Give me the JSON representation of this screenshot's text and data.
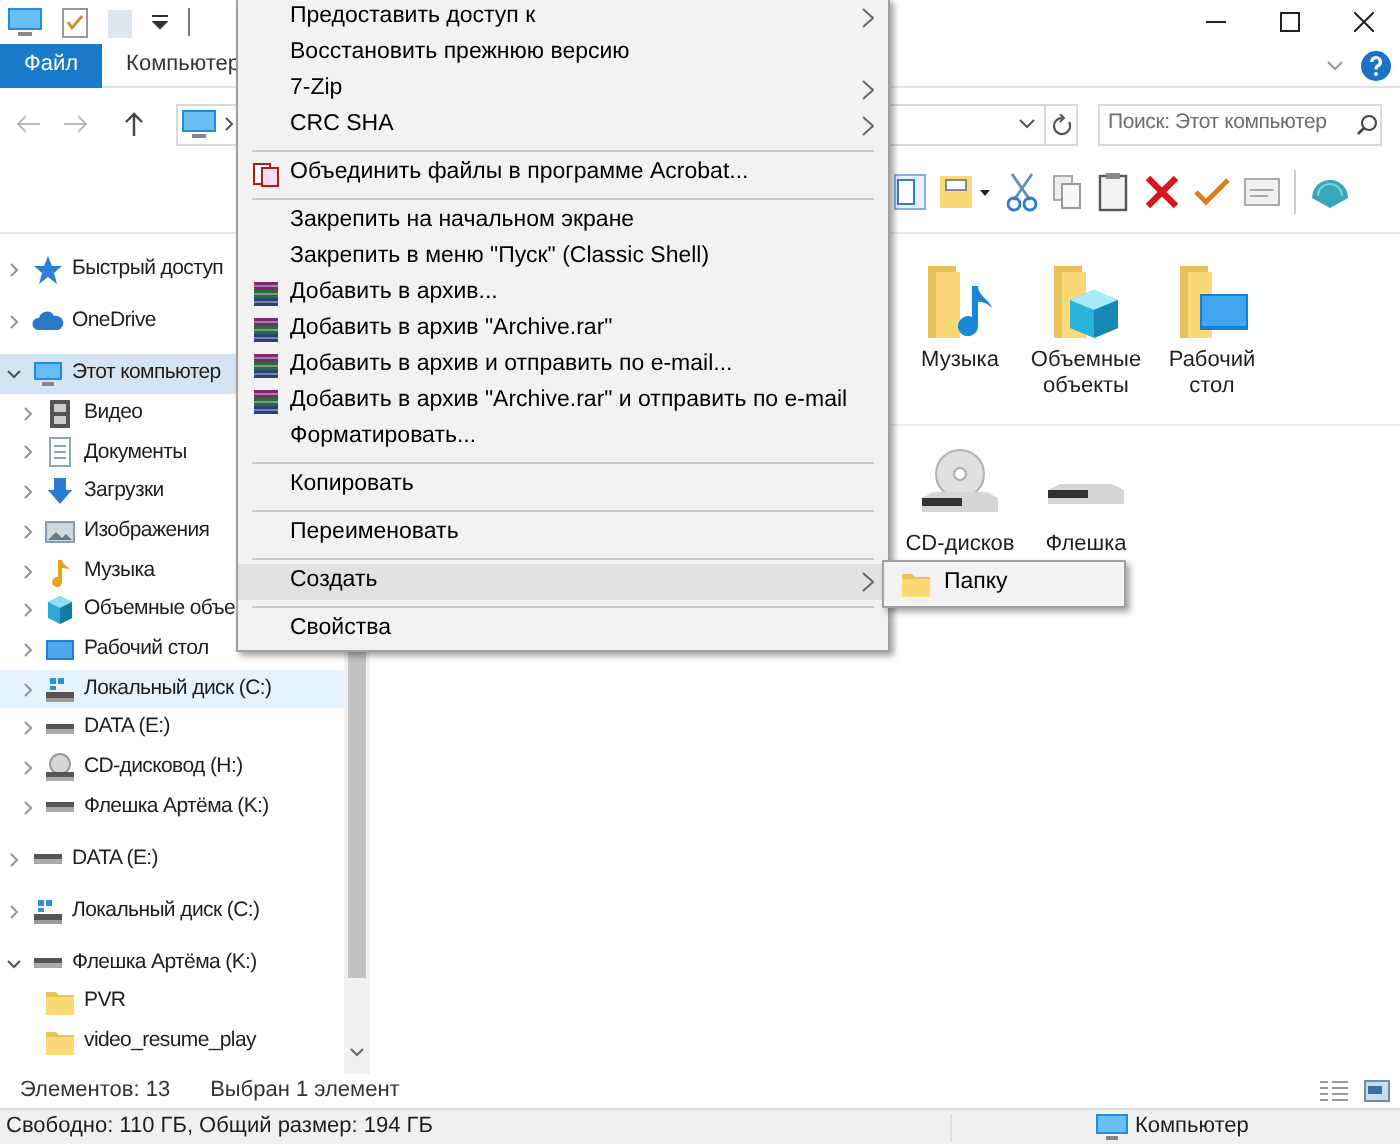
{
  "ribbon_tabs": [
    {
      "label": "Файл",
      "kind": "file"
    },
    {
      "label": "Компьютер",
      "kind": "tab"
    }
  ],
  "search": {
    "placeholder": "Поиск: Этот компьютер"
  },
  "navigation": [
    {
      "label": "Быстрый доступ",
      "kind": "star",
      "expanded": false,
      "selected": false,
      "hovered": false
    },
    {
      "label": "OneDrive",
      "kind": "cloud",
      "expanded": false,
      "selected": false,
      "hovered": false
    },
    {
      "label": "Этот компьютер",
      "kind": "pc",
      "expanded": true,
      "selected": true,
      "hovered": false,
      "children": [
        {
          "label": "Видео",
          "kind": "film",
          "expanded": false,
          "selected": false,
          "hovered": false
        },
        {
          "label": "Документы",
          "kind": "docs",
          "expanded": false,
          "selected": false,
          "hovered": false
        },
        {
          "label": "Загрузки",
          "kind": "download",
          "expanded": false,
          "selected": false,
          "hovered": false
        },
        {
          "label": "Изображения",
          "kind": "images",
          "expanded": false,
          "selected": false,
          "hovered": false
        },
        {
          "label": "Музыка",
          "kind": "music",
          "expanded": false,
          "selected": false,
          "hovered": false
        },
        {
          "label": "Объемные объе",
          "kind": "cube",
          "expanded": false,
          "selected": false,
          "hovered": false
        },
        {
          "label": "Рабочий стол",
          "kind": "desktop",
          "expanded": false,
          "selected": false,
          "hovered": false
        },
        {
          "label": "Локальный диск (C:)",
          "kind": "sysdisk",
          "expanded": false,
          "selected": false,
          "hovered": true
        },
        {
          "label": "DATA (E:)",
          "kind": "drive",
          "expanded": false,
          "selected": false,
          "hovered": false
        },
        {
          "label": "CD-дисковод (H:)",
          "kind": "cd",
          "expanded": false,
          "selected": false,
          "hovered": false
        },
        {
          "label": "Флешка Артёма (K:)",
          "kind": "drive",
          "expanded": false,
          "selected": false,
          "hovered": false
        }
      ]
    },
    {
      "label": "DATA (E:)",
      "kind": "drive",
      "expanded": false,
      "selected": false,
      "hovered": false
    },
    {
      "label": "Локальный диск (C:)",
      "kind": "sysdisk",
      "expanded": false,
      "selected": false,
      "hovered": false
    },
    {
      "label": "Флешка Артёма (K:)",
      "kind": "drive",
      "expanded": true,
      "selected": false,
      "hovered": false,
      "children": [
        {
          "label": "PVR",
          "kind": "folder",
          "selected": false,
          "hovered": false
        },
        {
          "label": "video_resume_play",
          "kind": "folder",
          "selected": false,
          "hovered": false
        }
      ]
    }
  ],
  "content": {
    "groups": [
      {
        "items": [
          {
            "label": "Музыка",
            "kind": "music"
          },
          {
            "label": "Объемные объекты",
            "kind": "cube"
          },
          {
            "label": "Рабочий стол",
            "kind": "desktop"
          }
        ]
      },
      {
        "items": [
          {
            "label": "CD-дисков",
            "kind": "cd"
          },
          {
            "label": "Флешка",
            "kind": "drive"
          }
        ]
      }
    ]
  },
  "status": {
    "item_count": "Элементов: 13",
    "selection": "Выбран 1 элемент"
  },
  "details_bar": {
    "free_space": "Свободно: 110 ГБ, Общий размер: 194 ГБ",
    "location": "Компьютер"
  },
  "context_menu": {
    "items": [
      {
        "kind": "item",
        "label": "Предоставить доступ к",
        "submenu": true,
        "selected": false
      },
      {
        "kind": "item",
        "label": "Восстановить прежнюю версию",
        "submenu": false,
        "selected": false
      },
      {
        "kind": "item",
        "label": "7-Zip",
        "submenu": true,
        "selected": false
      },
      {
        "kind": "item",
        "label": "CRC SHA",
        "submenu": true,
        "selected": false
      },
      {
        "kind": "separator"
      },
      {
        "kind": "acrobat",
        "label": "Объединить файлы в программе Acrobat...",
        "submenu": false,
        "selected": false
      },
      {
        "kind": "separator"
      },
      {
        "kind": "item",
        "label": "Закрепить на начальном экране",
        "submenu": false,
        "selected": false
      },
      {
        "kind": "item",
        "label": "Закрепить в меню \"Пуск\" (Classic Shell)",
        "submenu": false,
        "selected": false
      },
      {
        "kind": "archive",
        "label": "Добавить в архив...",
        "submenu": false,
        "selected": false
      },
      {
        "kind": "archive",
        "label": "Добавить в архив \"Archive.rar\"",
        "submenu": false,
        "selected": false
      },
      {
        "kind": "archive",
        "label": "Добавить в архив и отправить по e-mail...",
        "submenu": false,
        "selected": false
      },
      {
        "kind": "archive",
        "label": "Добавить в архив \"Archive.rar\" и отправить по e-mail",
        "submenu": false,
        "selected": false
      },
      {
        "kind": "item",
        "label": "Форматировать...",
        "submenu": false,
        "selected": false
      },
      {
        "kind": "separator"
      },
      {
        "kind": "item",
        "label": "Копировать",
        "submenu": false,
        "selected": false
      },
      {
        "kind": "separator"
      },
      {
        "kind": "item",
        "label": "Переименовать",
        "submenu": false,
        "selected": false
      },
      {
        "kind": "separator"
      },
      {
        "kind": "item",
        "label": "Создать",
        "submenu": true,
        "selected": true
      },
      {
        "kind": "separator"
      },
      {
        "kind": "item",
        "label": "Свойства",
        "submenu": false,
        "selected": false
      }
    ]
  },
  "submenu": {
    "items": [
      {
        "label": "Папку",
        "kind": "folder"
      }
    ]
  }
}
